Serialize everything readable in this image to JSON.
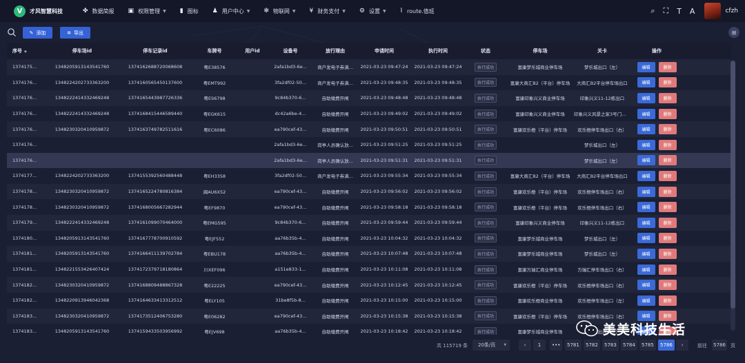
{
  "brand": {
    "logo_letter": "V",
    "name": "才风智慧科技"
  },
  "nav": [
    {
      "icon": "dashboard-icon",
      "glyph": "✤",
      "label": "数据简报",
      "caret": false
    },
    {
      "icon": "lock-icon",
      "glyph": "▣",
      "label": "权限管理",
      "caret": true
    },
    {
      "icon": "image-icon",
      "glyph": "▮",
      "label": "图标",
      "caret": false
    },
    {
      "icon": "user-icon",
      "glyph": "♟",
      "label": "用户中心",
      "caret": true
    },
    {
      "icon": "gear-icon",
      "glyph": "✻",
      "label": "物联网",
      "caret": true
    },
    {
      "icon": "yen-icon",
      "glyph": "¥",
      "label": "财务支付",
      "caret": true
    },
    {
      "icon": "settings-icon",
      "glyph": "⚙",
      "label": "设置",
      "caret": true
    },
    {
      "icon": "route-icon",
      "glyph": "⌇",
      "label": "route.值班",
      "caret": false
    }
  ],
  "user": {
    "name": "cfzh"
  },
  "toolbar": {
    "add_label": "添加",
    "export_label": "导出"
  },
  "table": {
    "headers": [
      "序号",
      "停车场id",
      "停车记录id",
      "车牌号",
      "用户id",
      "设备号",
      "放行理由",
      "申请时间",
      "执行时间",
      "状态",
      "停车场",
      "关卡",
      "操作"
    ],
    "edit_label": "编辑",
    "delete_label": "删除",
    "rows": [
      [
        "1374175...",
        "1348205913143541760",
        "1374162688720068608",
        "粤E38576",
        "",
        "2afa1bd3-6e...",
        "商户发电子券满...",
        "2021-03-23 09:47:24",
        "2021-03-23 09:47:24",
        "执行成功",
        "富康梦乐城商业停车场",
        "梦乐城出口（左）"
      ],
      [
        "1374176...",
        "1348224202733363200",
        "1374160565450137600",
        "粤EMT992",
        "",
        "3fa2df02-50...",
        "商户发电子券满...",
        "2021-03-23 09:48:35",
        "2021-03-23 09:48:35",
        "执行成功",
        "富康大商汇B2（平台）停车场",
        "大商汇B2平台停车场出口"
      ],
      [
        "1374176...",
        "1348222414332469248",
        "1374165443987726336",
        "粤ES6798",
        "",
        "9c84b370-6...",
        "自助缴费开闸",
        "2021-03-23 09:48:48",
        "2021-03-23 09:48:48",
        "执行成功",
        "富康印象兴义商业停车场",
        "印象兴义11-12栋出口"
      ],
      [
        "1374176...",
        "1348222414332469248",
        "1374168415446589440",
        "粤EGK615",
        "",
        "dc42a6be-4...",
        "自助缴费开闸",
        "2021-03-23 09:49:02",
        "2021-03-23 09:49:02",
        "执行成功",
        "富康印象兴义商业停车场",
        "印象兴义风景之家3号门出口"
      ],
      [
        "1374176...",
        "1348230320410959872",
        "1374163749782511616",
        "粤EC6086",
        "",
        "ea790cef-43...",
        "自助缴费开闸",
        "2021-03-23 09:50:51",
        "2021-03-23 09:50:51",
        "执行成功",
        "富康欢乐橙（平台）停车场",
        "欢乐橙停车场出口（右）"
      ],
      [
        "1374176...",
        "",
        "",
        "",
        "",
        "2afa1bd3-6e...",
        "岗亭人员确认放...",
        "2021-03-23 09:51:25",
        "2021-03-23 09:51:25",
        "执行成功",
        "",
        "梦乐城出口（左）"
      ],
      [
        "1374176...",
        "",
        "",
        "",
        "",
        "2afa1bd3-6e...",
        "岗亭人员确认放...",
        "2021-03-23 09:51:31",
        "2021-03-23 09:51:31",
        "执行成功",
        "",
        "梦乐城出口（左）"
      ],
      [
        "1374177...",
        "1348224202733363200",
        "1374155392560488448",
        "粤EH3358",
        "",
        "3fa2df02-50...",
        "商户发电子券满...",
        "2021-03-23 09:55:34",
        "2021-03-23 09:55:34",
        "执行成功",
        "富康大商汇B2（平台）停车场",
        "大商汇B2平台停车场出口"
      ],
      [
        "1374178...",
        "1348230320410959872",
        "1374165224780816384",
        "闽AU6X52",
        "",
        "ea790cef-43...",
        "自助缴费开闸",
        "2021-03-23 09:56:02",
        "2021-03-23 09:56:02",
        "执行成功",
        "富康欢乐橙（平台）停车场",
        "欢乐橙停车场出口（右）"
      ],
      [
        "1374178...",
        "1348230320410959872",
        "1374168005667282944",
        "粤EF9870",
        "",
        "ea790cef-43...",
        "自助缴费开闸",
        "2021-03-23 09:58:18",
        "2021-03-23 09:58:18",
        "执行成功",
        "富康欢乐橙（平台）停车场",
        "欢乐橙停车场出口（右）"
      ],
      [
        "1374179...",
        "1348222414332469248",
        "1374161099070464000",
        "粤EMG595",
        "",
        "9c84b370-6...",
        "自助缴费开闸",
        "2021-03-23 09:59:44",
        "2021-03-23 09:59:44",
        "执行成功",
        "富康印象兴义商业停车场",
        "印象兴义11-12栋出口"
      ],
      [
        "1374180...",
        "1348205913143541760",
        "1374167778700910592",
        "粤EJF552",
        "",
        "aa76b35b-4...",
        "自助缴费开闸",
        "2021-03-23 10:04:32",
        "2021-03-23 10:04:32",
        "执行成功",
        "富康梦乐城商业停车场",
        "梦乐城出口（左）"
      ],
      [
        "1374181...",
        "1348205913143541760",
        "1374166411139702784",
        "粤EBU178",
        "",
        "aa76b35b-4...",
        "自助缴费开闸",
        "2021-03-23 10:07:48",
        "2021-03-23 10:07:48",
        "执行成功",
        "富康梦乐城商业停车场",
        "梦乐城出口（左）"
      ],
      [
        "1374181...",
        "1348221553426407424",
        "1374172379718180864",
        "川XEF096",
        "",
        "a151e833-1...",
        "自助缴费开闸",
        "2021-03-23 10:11:08",
        "2021-03-23 10:11:08",
        "执行成功",
        "富康万瑞汇商业停车场",
        "万瑞汇停车场出口（右）"
      ],
      [
        "1374182...",
        "1348230320410959872",
        "1374168809488867328",
        "粤E22225",
        "",
        "ea790cef-43...",
        "自助缴费开闸",
        "2021-03-23 10:12:45",
        "2021-03-23 10:12:45",
        "执行成功",
        "富康欢乐橙（平台）停车场",
        "欢乐橙停车场出口（右）"
      ],
      [
        "1374182...",
        "1348220913946042368",
        "1374164633413312512",
        "粤ELY105",
        "",
        "31be8f5b-8...",
        "自助缴费开闸",
        "2021-03-23 10:15:00",
        "2021-03-23 10:15:00",
        "执行成功",
        "富康欢乐橙商业停车场",
        "欢乐橙停车场出口（左）"
      ],
      [
        "1374183...",
        "1348230320410959872",
        "1374173512406753280",
        "粤E06282",
        "",
        "ea790cef-43...",
        "自助缴费开闸",
        "2021-03-23 10:15:38",
        "2021-03-23 10:15:38",
        "执行成功",
        "富康欢乐橙（平台）停车场",
        "欢乐橙停车场出口（右）"
      ],
      [
        "1374183...",
        "1348205913143541760",
        "1374159433503956992",
        "粤EJV698",
        "",
        "aa76b35b-4...",
        "自助缴费开闸",
        "2021-03-23 10:18:42",
        "2021-03-23 10:18:42",
        "执行成功",
        "富康梦乐城商业停车场",
        "梦乐城出口（左）"
      ]
    ]
  },
  "pagination": {
    "total_text": "共 115719 条",
    "page_size": "20条/页",
    "prev": "‹",
    "next": "›",
    "pages": [
      "1",
      "•••",
      "5781",
      "5782",
      "5783",
      "5784",
      "5785",
      "5786"
    ],
    "current": "5786",
    "goto_label": "前往",
    "goto_value": "5786",
    "goto_unit": "页"
  },
  "watermark": {
    "text": "美美科技生活"
  },
  "colors": {
    "accent": "#3563d6",
    "danger": "#e07a7a",
    "background": "#1b1f33",
    "topbar": "#141727",
    "highlight_row": "#343853"
  }
}
